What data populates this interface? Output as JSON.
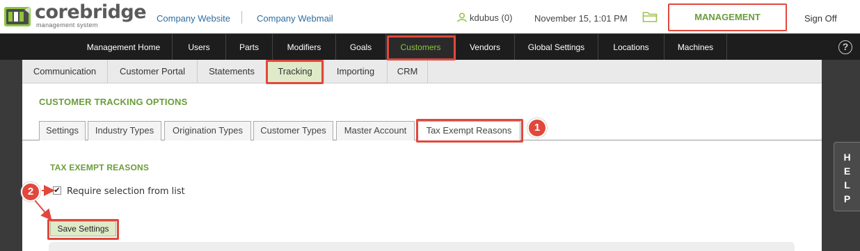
{
  "header": {
    "logo_word": "corebridge",
    "logo_tagline": "management system",
    "links": [
      "Company Website",
      "Company Webmail"
    ],
    "user": "kdubus (0)",
    "datetime": "November 15, 1:01 PM",
    "management_label": "MANAGEMENT",
    "signoff_label": "Sign Off",
    "accent_color": "#6a9c3a"
  },
  "main_nav": {
    "items": [
      "Management Home",
      "Users",
      "Parts",
      "Modifiers",
      "Goals",
      "Customers",
      "Vendors",
      "Global Settings",
      "Locations",
      "Machines"
    ],
    "active": "Customers",
    "help_glyph": "?"
  },
  "sub_nav": {
    "items": [
      "Communication",
      "Customer Portal",
      "Statements",
      "Tracking",
      "Importing",
      "CRM"
    ],
    "active": "Tracking"
  },
  "page": {
    "title": "CUSTOMER TRACKING OPTIONS",
    "tabs": [
      "Settings",
      "Industry Types",
      "Origination Types",
      "Customer Types",
      "Master Account",
      "Tax Exempt Reasons"
    ],
    "active_tab": "Tax Exempt Reasons",
    "section_title": "TAX EXEMPT REASONS",
    "require_checkbox": {
      "label": "Require selection from list",
      "checked": true
    },
    "save_button": "Save Settings"
  },
  "help_tab": {
    "letters": [
      "H",
      "E",
      "L",
      "P"
    ]
  },
  "annotations": {
    "badges": [
      "1",
      "2"
    ],
    "color": "#e2473c"
  }
}
